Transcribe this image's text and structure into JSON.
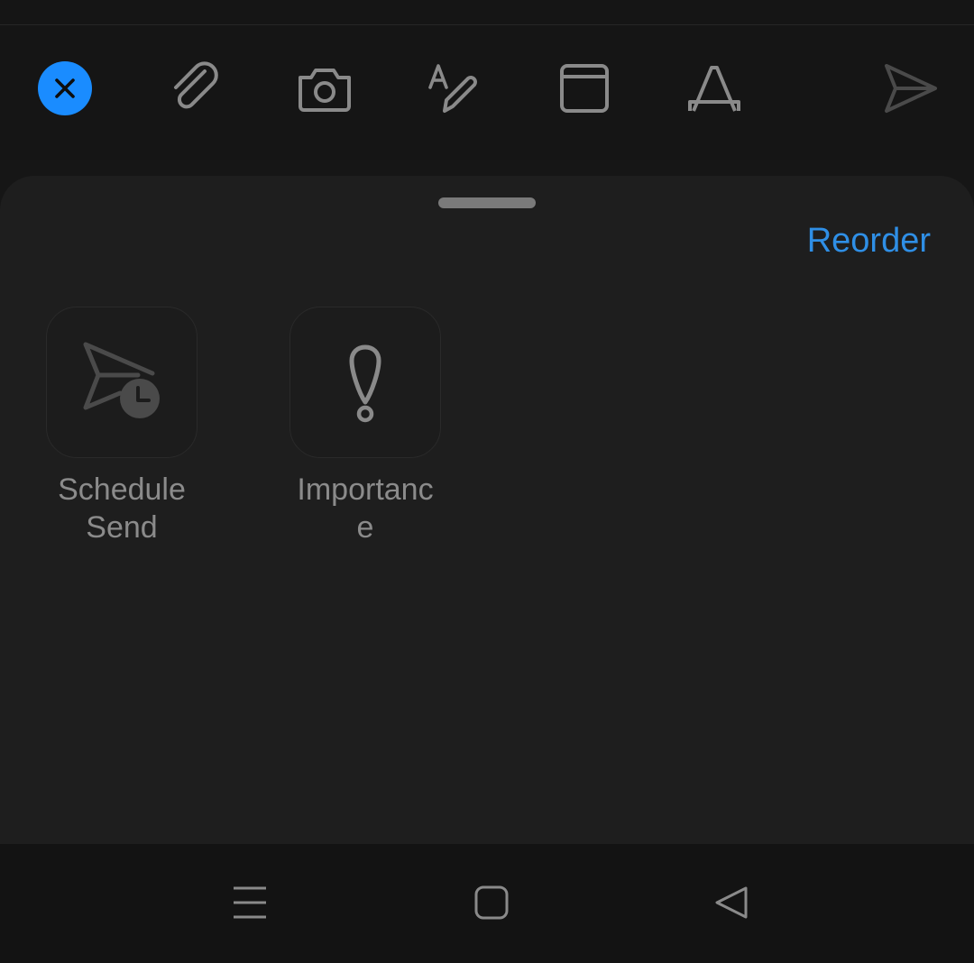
{
  "colors": {
    "background": "#161616",
    "sheet": "#1e1e1e",
    "accent": "#1a8cff",
    "link": "#2f8fe6",
    "icon": "#8a8a8a",
    "disabled_icon": "#4a4a4a",
    "label": "#8b8b8b"
  },
  "toolbar": {
    "icons": [
      "close-icon",
      "paperclip-icon",
      "camera-icon",
      "draw-icon",
      "window-icon",
      "text-format-icon",
      "send-icon"
    ]
  },
  "sheet": {
    "reorder_label": "Reorder",
    "actions": [
      {
        "icon": "schedule-send-icon",
        "label": "Schedule Send"
      },
      {
        "icon": "importance-icon",
        "label": "Importance"
      }
    ]
  },
  "navbar": {
    "icons": [
      "menu-icon",
      "home-square-icon",
      "back-triangle-icon"
    ]
  }
}
